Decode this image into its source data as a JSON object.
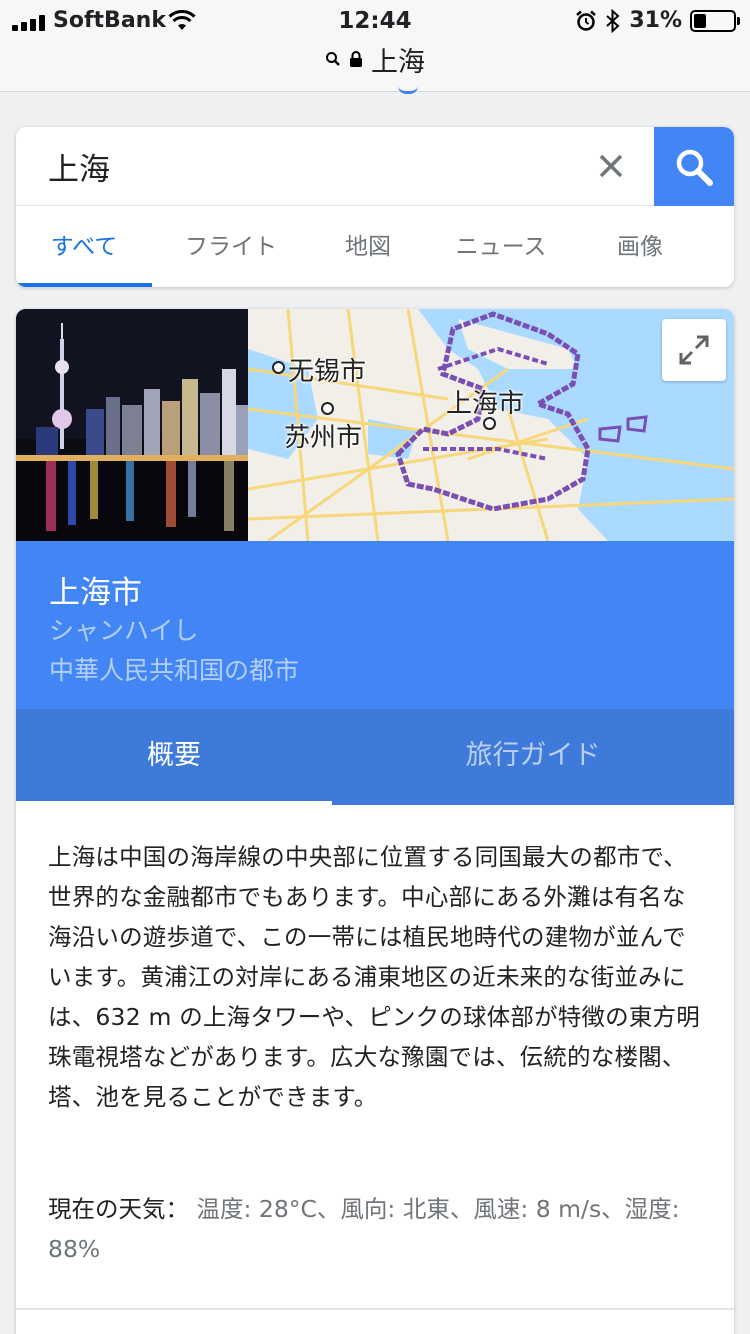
{
  "status_bar": {
    "carrier": "SoftBank",
    "time": "12:44",
    "battery_percent": "31%",
    "battery_level": 0.31,
    "icons": [
      "signal-icon",
      "wifi-icon",
      "alarm-icon",
      "bluetooth-icon",
      "battery-icon"
    ]
  },
  "url_bar": {
    "text": "上海",
    "icons": [
      "search-icon",
      "lock-icon"
    ]
  },
  "search": {
    "query": "上海",
    "tabs": [
      {
        "label": "すべて",
        "active": true
      },
      {
        "label": "フライト",
        "active": false
      },
      {
        "label": "地図",
        "active": false
      },
      {
        "label": "ニュース",
        "active": false
      },
      {
        "label": "画像",
        "active": false
      }
    ],
    "accent_color": "#4285f4",
    "active_tab_color": "#1a73e8"
  },
  "knowledge_panel": {
    "map_labels": {
      "wuxi": "无锡市",
      "suzhou": "苏州市",
      "shanghai": "上海市"
    },
    "title": "上海市",
    "reading": "シャンハイし",
    "subtitle": "中華人民共和国の都市",
    "header_color": "#4285f4",
    "tabs": [
      {
        "label": "概要",
        "active": true
      },
      {
        "label": "旅行ガイド",
        "active": false
      }
    ],
    "description": "上海は中国の海岸線の中央部に位置する同国最大の都市で、世界的な金融都市でもあります。中心部にある外灘は有名な海沿いの遊歩道で、この一帯には植民地時代の建物が並んでいます。黄浦江の対岸にある浦東地区の近未来的な街並みには、632 m の上海タワーや、ピンクの球体部が特徴の東方明珠電視塔などがあります。広大な豫園では、伝統的な楼閣、塔、池を見ることができます。",
    "weather": {
      "label": "現在の天気：",
      "value": "温度: 28°C、風向: 北東、風速: 8 m/s、湿度: 88%"
    }
  }
}
